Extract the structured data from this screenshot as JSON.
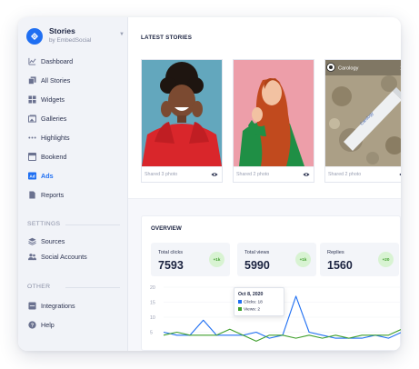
{
  "app": {
    "title": "Stories",
    "subtitle": "by EmbedSocial",
    "brand_color": "#1f6ff2"
  },
  "sidebar": {
    "items": [
      {
        "label": "Dashboard",
        "icon": "chart-icon"
      },
      {
        "label": "All Stories",
        "icon": "stories-icon"
      },
      {
        "label": "Widgets",
        "icon": "widgets-icon"
      },
      {
        "label": "Galleries",
        "icon": "galleries-icon"
      },
      {
        "label": "Highlights",
        "icon": "dots-icon"
      },
      {
        "label": "Bookend",
        "icon": "bookend-icon"
      },
      {
        "label": "Ads",
        "icon": "ads-icon",
        "active": true
      },
      {
        "label": "Reports",
        "icon": "report-icon"
      }
    ],
    "settings_label": "SETTINGS",
    "settings_items": [
      {
        "label": "Sources",
        "icon": "layers-icon"
      },
      {
        "label": "Social Accounts",
        "icon": "users-icon"
      }
    ],
    "other_label": "OTHER",
    "other_items": [
      {
        "label": "Integrations",
        "icon": "integrations-icon"
      },
      {
        "label": "Help",
        "icon": "help-icon"
      }
    ]
  },
  "latest_stories": {
    "title": "LATEST STORIES",
    "cards": [
      {
        "caption": "Shared 3 photo"
      },
      {
        "caption": "Shared 2 photo"
      },
      {
        "caption": "Shared 2 photo",
        "account": "Carology",
        "product_text": "Carology",
        "page": "1"
      }
    ]
  },
  "overview": {
    "title": "OVERVIEW",
    "stats": [
      {
        "label": "Total clicks",
        "value": "7593",
        "badge": "+1k"
      },
      {
        "label": "Total views",
        "value": "5990",
        "badge": "+1k"
      },
      {
        "label": "Replies",
        "value": "1560",
        "badge": "+20"
      }
    ],
    "tooltip": {
      "date": "Oct 8, 2020",
      "clicks": "Clicks: 18",
      "views": "Views: 2"
    }
  },
  "chart_data": {
    "type": "line",
    "yticks": [
      "20",
      "15",
      "10",
      "5"
    ],
    "ylim": [
      5,
      20
    ],
    "x": [
      0,
      1,
      2,
      3,
      4,
      5,
      6,
      7,
      8,
      9,
      10,
      11,
      12,
      13,
      14,
      15,
      16,
      17,
      18
    ],
    "series": [
      {
        "name": "Clicks",
        "color": "#1f6ff2",
        "values": [
          5,
          4,
          4,
          9,
          4,
          4,
          4,
          5,
          3,
          4,
          17,
          5,
          4,
          3,
          3,
          3,
          4,
          3,
          5
        ]
      },
      {
        "name": "Views",
        "color": "#3f9f2c",
        "values": [
          4,
          5,
          4,
          4,
          4,
          6,
          4,
          2,
          4,
          4,
          3,
          4,
          3,
          4,
          3,
          4,
          4,
          4,
          6
        ]
      }
    ]
  }
}
